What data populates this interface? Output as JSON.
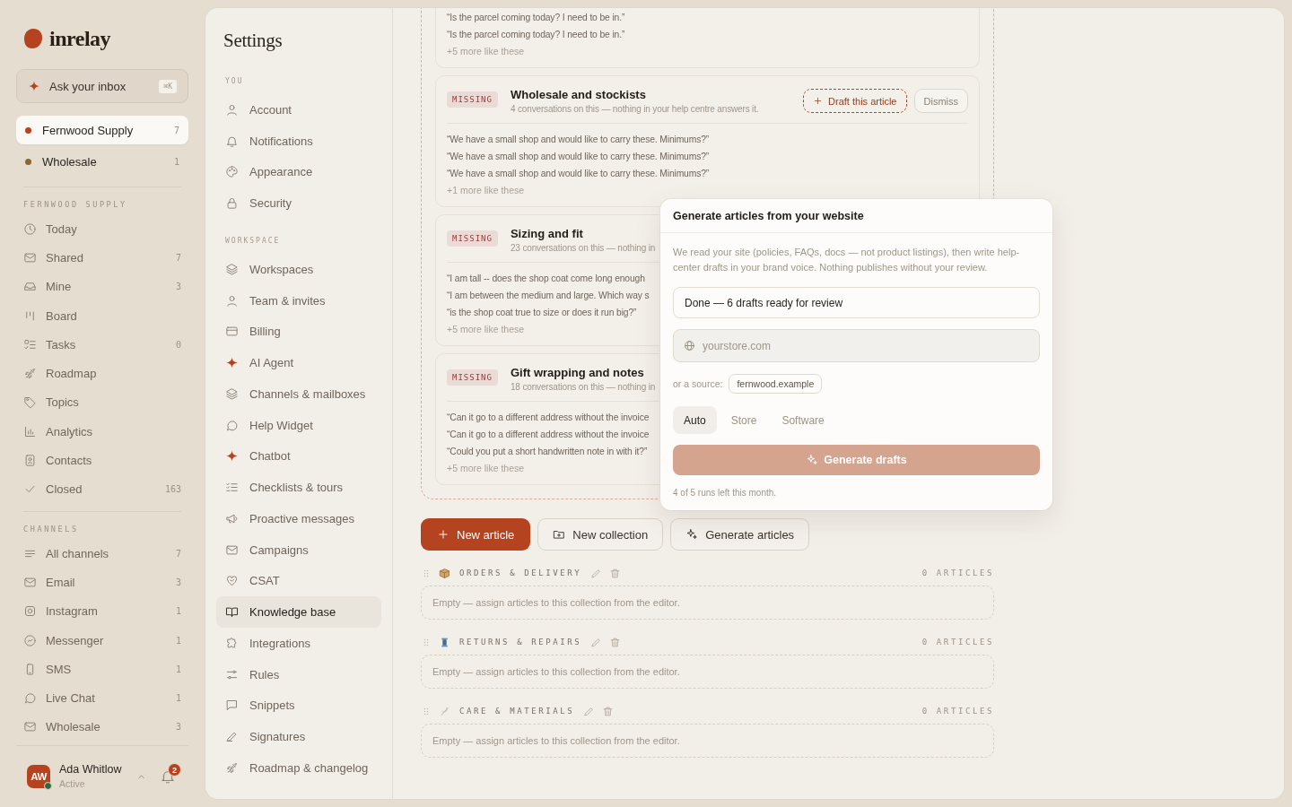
{
  "sidebar": {
    "brand": "inrelay",
    "ask": {
      "label": "Ask your inbox",
      "shortcut": "⌘K"
    },
    "workspaces": [
      {
        "name": "Fernwood Supply",
        "count": "7",
        "color": "#b5431f",
        "selected": true
      },
      {
        "name": "Wholesale",
        "count": "1",
        "color": "#8a6a2c",
        "selected": false
      }
    ],
    "sections": [
      {
        "title": "FERNWOOD SUPPLY",
        "items": [
          {
            "label": "Today"
          },
          {
            "label": "Shared",
            "count": "7"
          },
          {
            "label": "Mine",
            "count": "3"
          },
          {
            "label": "Board"
          },
          {
            "label": "Tasks",
            "count": "0"
          },
          {
            "label": "Roadmap"
          },
          {
            "label": "Topics"
          },
          {
            "label": "Analytics"
          },
          {
            "label": "Contacts"
          },
          {
            "label": "Closed",
            "count": "163"
          }
        ]
      },
      {
        "title": "CHANNELS",
        "items": [
          {
            "label": "All channels",
            "count": "7"
          },
          {
            "label": "Email",
            "count": "3"
          },
          {
            "label": "Instagram",
            "count": "1"
          },
          {
            "label": "Messenger",
            "count": "1"
          },
          {
            "label": "SMS",
            "count": "1"
          },
          {
            "label": "Live Chat",
            "count": "1"
          },
          {
            "label": "Wholesale",
            "count": "3"
          }
        ]
      }
    ],
    "user": {
      "initials": "AW",
      "name": "Ada Whitlow",
      "status": "Active",
      "notifications": "2"
    }
  },
  "settings": {
    "title": "Settings",
    "groups": [
      {
        "title": "YOU",
        "items": [
          {
            "label": "Account",
            "selected": false
          },
          {
            "label": "Notifications",
            "selected": false
          },
          {
            "label": "Appearance",
            "selected": false
          },
          {
            "label": "Security",
            "selected": false
          }
        ]
      },
      {
        "title": "WORKSPACE",
        "items": [
          {
            "label": "Workspaces",
            "selected": false
          },
          {
            "label": "Team & invites",
            "selected": false
          },
          {
            "label": "Billing",
            "selected": false
          },
          {
            "label": "AI Agent",
            "selected": false
          },
          {
            "label": "Channels & mailboxes",
            "selected": false
          },
          {
            "label": "Help Widget",
            "selected": false
          },
          {
            "label": "Chatbot",
            "selected": false
          },
          {
            "label": "Checklists & tours",
            "selected": false
          },
          {
            "label": "Proactive messages",
            "selected": false
          },
          {
            "label": "Campaigns",
            "selected": false
          },
          {
            "label": "CSAT",
            "selected": false
          },
          {
            "label": "Knowledge base",
            "selected": true
          },
          {
            "label": "Integrations",
            "selected": false
          },
          {
            "label": "Rules",
            "selected": false
          },
          {
            "label": "Snippets",
            "selected": false
          },
          {
            "label": "Signatures",
            "selected": false
          },
          {
            "label": "Roadmap & changelog",
            "selected": false
          }
        ]
      }
    ]
  },
  "knowledge_base": {
    "gaps": [
      {
        "quotes": [
          "“Is the parcel coming today? I need to be in.”",
          "“Is the parcel coming today? I need to be in.”"
        ],
        "more": "+5 more like these"
      },
      {
        "badge": "MISSING",
        "title": "Wholesale and stockists",
        "subtitle": "4 conversations on this — nothing in your help centre answers it.",
        "actions": [
          {
            "label": "Draft this article",
            "kind": "draft"
          },
          {
            "label": "Dismiss",
            "kind": "dismiss"
          }
        ],
        "quotes": [
          "“We have a small shop and would like to carry these. Minimums?”",
          "“We have a small shop and would like to carry these. Minimums?”",
          "“We have a small shop and would like to carry these. Minimums?”"
        ],
        "more": "+1 more like these"
      },
      {
        "badge": "MISSING",
        "title": "Sizing and fit",
        "subtitle": "23 conversations on this — nothing in",
        "quotes": [
          "“I am tall -- does the shop coat come long enough",
          "“I am between the medium and large. Which way s",
          "“is the shop coat true to size or does it run big?”"
        ],
        "more": "+5 more like these"
      },
      {
        "badge": "MISSING",
        "title": "Gift wrapping and notes",
        "subtitle": "18 conversations on this — nothing in",
        "quotes": [
          "“Can it go to a different address without the invoice",
          "“Can it go to a different address without the invoice",
          "“Could you put a short handwritten note in with it?”"
        ],
        "more": "+5 more like these"
      }
    ],
    "actions": [
      {
        "label": "New article",
        "kind": "primary"
      },
      {
        "label": "New collection",
        "kind": "collection"
      },
      {
        "label": "Generate articles",
        "kind": "generate"
      }
    ],
    "collections": [
      {
        "name": "ORDERS & DELIVERY",
        "count": "0 ARTICLES",
        "empty": "Empty — assign articles to this collection from the editor."
      },
      {
        "name": "RETURNS & REPAIRS",
        "count": "0 ARTICLES",
        "empty": "Empty — assign articles to this collection from the editor."
      },
      {
        "name": "CARE & MATERIALS",
        "count": "0 ARTICLES",
        "empty": "Empty — assign articles to this collection from the editor."
      }
    ],
    "generator": {
      "title": "Generate articles from your website",
      "description": "We read your site (policies, FAQs, docs — not product listings), then write help-center drafts in your brand voice. Nothing publishes without your review.",
      "status": "Done — 6 drafts ready for review",
      "url_placeholder": "yourstore.com",
      "source_label": "or a source:",
      "sources": [
        "fernwood.example"
      ],
      "modes": [
        {
          "label": "Auto",
          "selected": true
        },
        {
          "label": "Store",
          "selected": false
        },
        {
          "label": "Software",
          "selected": false
        }
      ],
      "button": {
        "label": "Generate drafts",
        "disabled": true
      },
      "note": "4 of 5 runs left this month."
    }
  }
}
